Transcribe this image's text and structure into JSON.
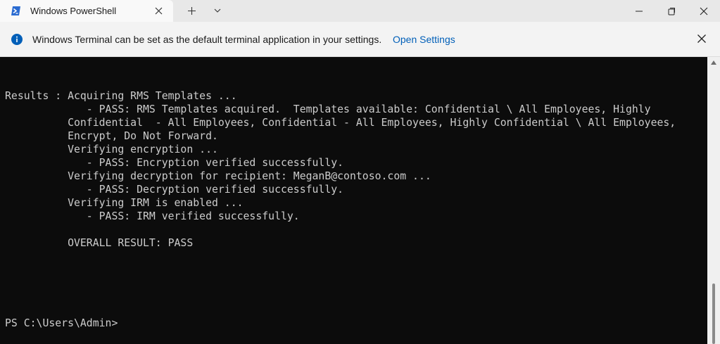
{
  "tab": {
    "title": "Windows PowerShell",
    "icon": "powershell-icon"
  },
  "window_controls": [
    "minimize-icon",
    "maximize-icon",
    "close-icon"
  ],
  "infobar": {
    "message": "Windows Terminal can be set as the default terminal application in your settings.",
    "link_label": "Open Settings",
    "icon": "info-icon"
  },
  "terminal": {
    "lines": [
      "Results : Acquiring RMS Templates ...",
      "             - PASS: RMS Templates acquired.  Templates available: Confidential \\ All Employees, Highly",
      "          Confidential  - All Employees, Confidential - All Employees, Highly Confidential \\ All Employees,",
      "          Encrypt, Do Not Forward.",
      "          Verifying encryption ...",
      "             - PASS: Encryption verified successfully.",
      "          Verifying decryption for recipient: MeganB@contoso.com ...",
      "             - PASS: Decryption verified successfully.",
      "          Verifying IRM is enabled ...",
      "             - PASS: IRM verified successfully.",
      "",
      "          OVERALL RESULT: PASS"
    ],
    "prompt": "PS C:\\Users\\Admin>"
  },
  "colors": {
    "terminal_bg": "#0c0c0c",
    "terminal_fg": "#cccccc",
    "link": "#005fb8",
    "info_icon": "#005fb8"
  }
}
